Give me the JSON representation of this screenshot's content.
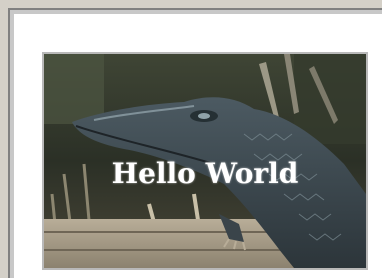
{
  "image": {
    "caption": "Hello World",
    "subject": "alligator-photo"
  },
  "colors": {
    "window_bg": "#d4d0c8",
    "paper_bg": "#ffffff",
    "caption_color": "#ffffff"
  }
}
